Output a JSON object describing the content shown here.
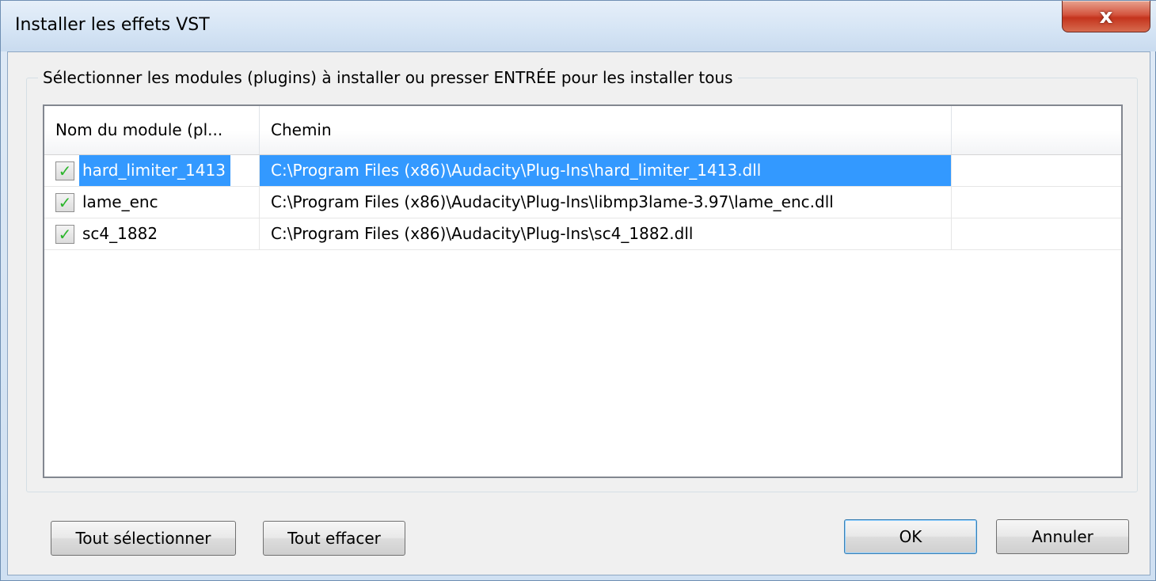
{
  "window": {
    "title": "Installer les effets VST",
    "close_label": "x"
  },
  "group": {
    "label": "Sélectionner les modules (plugins) à installer ou presser ENTRÉE pour les installer tous"
  },
  "list": {
    "columns": [
      "Nom du  module (pl...",
      "Chemin"
    ],
    "rows": [
      {
        "name": "hard_limiter_1413",
        "path": "C:\\Program Files (x86)\\Audacity\\Plug-Ins\\hard_limiter_1413.dll",
        "checked": true,
        "selected": true
      },
      {
        "name": "lame_enc",
        "path": "C:\\Program Files (x86)\\Audacity\\Plug-Ins\\libmp3lame-3.97\\lame_enc.dll",
        "checked": true,
        "selected": false
      },
      {
        "name": "sc4_1882",
        "path": "C:\\Program Files (x86)\\Audacity\\Plug-Ins\\sc4_1882.dll",
        "checked": true,
        "selected": false
      }
    ]
  },
  "buttons": {
    "select_all": "Tout sélectionner",
    "clear_all": "Tout effacer",
    "ok": "OK",
    "cancel": "Annuler"
  },
  "colors": {
    "selection": "#3399ff",
    "checkmark": "#2bb52b"
  },
  "icons": {
    "close": "close-icon",
    "check": "checkmark-icon"
  }
}
